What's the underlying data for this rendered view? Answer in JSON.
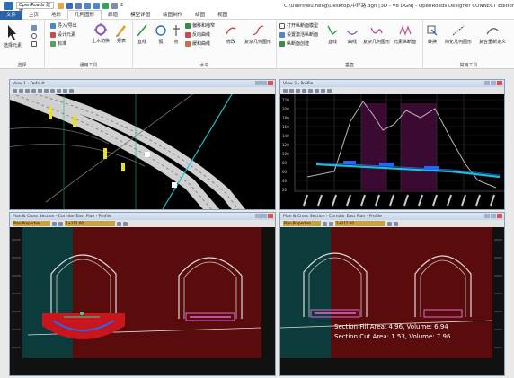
{
  "app": {
    "workspace_select": "OpenRoads 建模",
    "window_title": "C:\\Users\\wu.heng\\Desktop\\中环路.dgn [3D - V8 DGN] - OpenRoads Designer CONNECT Edition",
    "quick_access_extra": "2"
  },
  "menu": [
    "文件",
    "主页",
    "地形",
    "几何图形",
    "廊道",
    "模型详图",
    "绘图制作",
    "绘图",
    "视图"
  ],
  "ribbon": {
    "select_group": {
      "label": "选择",
      "tools": [
        "选择元素"
      ]
    },
    "general_group": {
      "label": "通用工具",
      "tools": [
        "导入/导出",
        "设计元素",
        "标准",
        "土木切换",
        "报表"
      ]
    },
    "horizontal_group": {
      "label": "水平",
      "tools": [
        "直线",
        "弧",
        "点",
        "偏移和缩窄",
        "反向曲线",
        "缓和曲线",
        "修改",
        "复杂几何图形"
      ]
    },
    "vertical_group": {
      "label": "垂直",
      "tools": [
        "打开纵断面模型",
        "设置激活纵断面",
        "纵断面创建",
        "直线",
        "曲线",
        "复杂几何图形",
        "元素纵断面"
      ]
    },
    "common_group": {
      "label": "常用工具",
      "tools": [
        "转换",
        "简化几何图形",
        "复合重新定义"
      ]
    }
  },
  "views": {
    "plan": {
      "title": "View 1 - Default"
    },
    "cross_left": {
      "title": "Plan & Cross Section - Corridor East Plan - Profile",
      "station_left": "Plan Properties",
      "station_right": "2+112.00"
    },
    "profile": {
      "title": "View 3 - Profile"
    },
    "cross_right": {
      "title": "Plan & Cross Section - Corridor East Plan - Profile",
      "station_left": "Plan Properties",
      "station_right": "2+112.00"
    }
  },
  "section_results": {
    "fill": "Section Fill Area: 4.96, Volume: 6.94",
    "cut": "Section Cut Area: 1.53, Volume: 7.96"
  },
  "profile_axis": {
    "y_ticks": [
      "220",
      "200",
      "180",
      "160",
      "140",
      "120",
      "100",
      "80",
      "60",
      "40",
      "20"
    ]
  },
  "colors": {
    "file_tab": "#2b62a8",
    "design_line": "#18c2d4",
    "cut_red": "#5a0b0b",
    "fill_green": "#0c3b3b",
    "profile_pink": "#d65fbf"
  }
}
